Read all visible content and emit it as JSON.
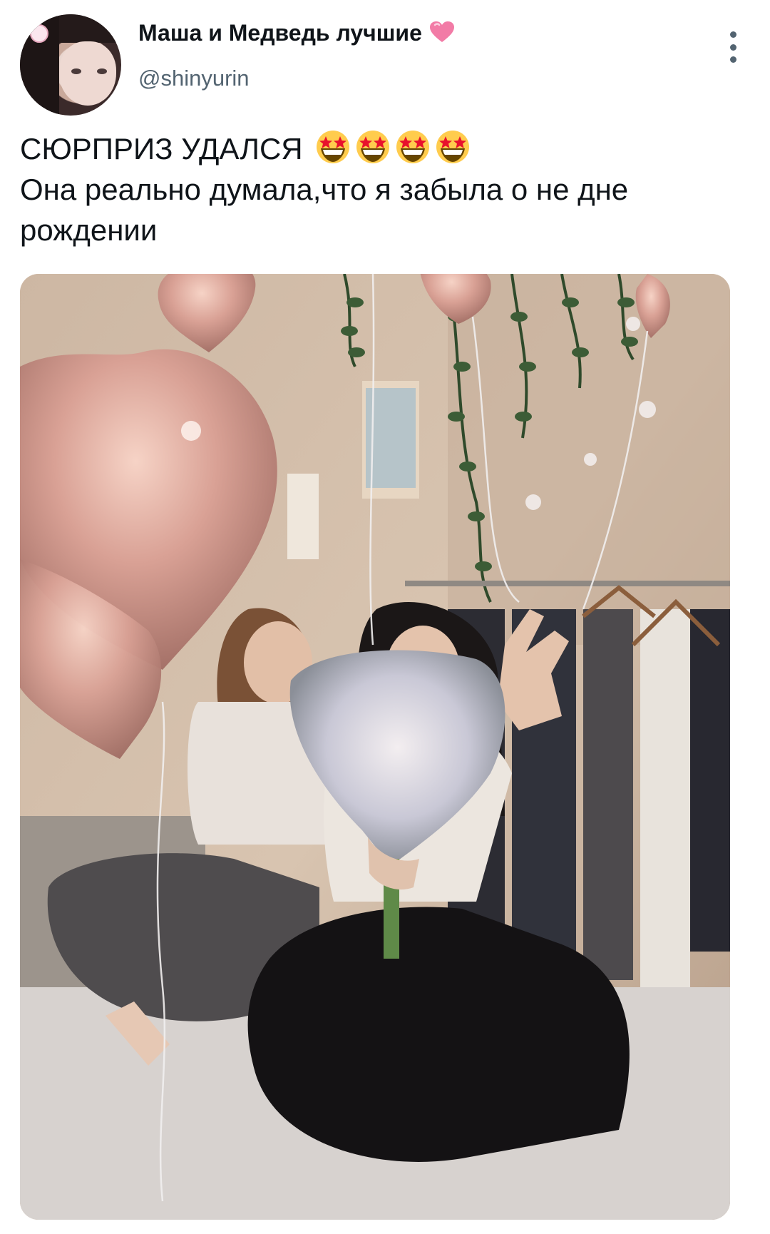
{
  "tweet": {
    "author": {
      "display_name": "Маша и Медведь лучшие",
      "name_emoji": "pink-heart-icon",
      "handle": "@shinyurin"
    },
    "text_line1": "СЮРПРИЗ УДАЛСЯ",
    "line1_emojis": [
      "star-struck-emoji",
      "star-struck-emoji",
      "star-struck-emoji",
      "star-struck-emoji"
    ],
    "text_line2": "Она реально думала,что я забыла о не дне рождении",
    "photo": {
      "description_icon": "photo-icon"
    }
  },
  "colors": {
    "text_primary": "#0f1419",
    "text_secondary": "#536471",
    "heart": "#f27ba6",
    "balloon": "#d9a195"
  }
}
